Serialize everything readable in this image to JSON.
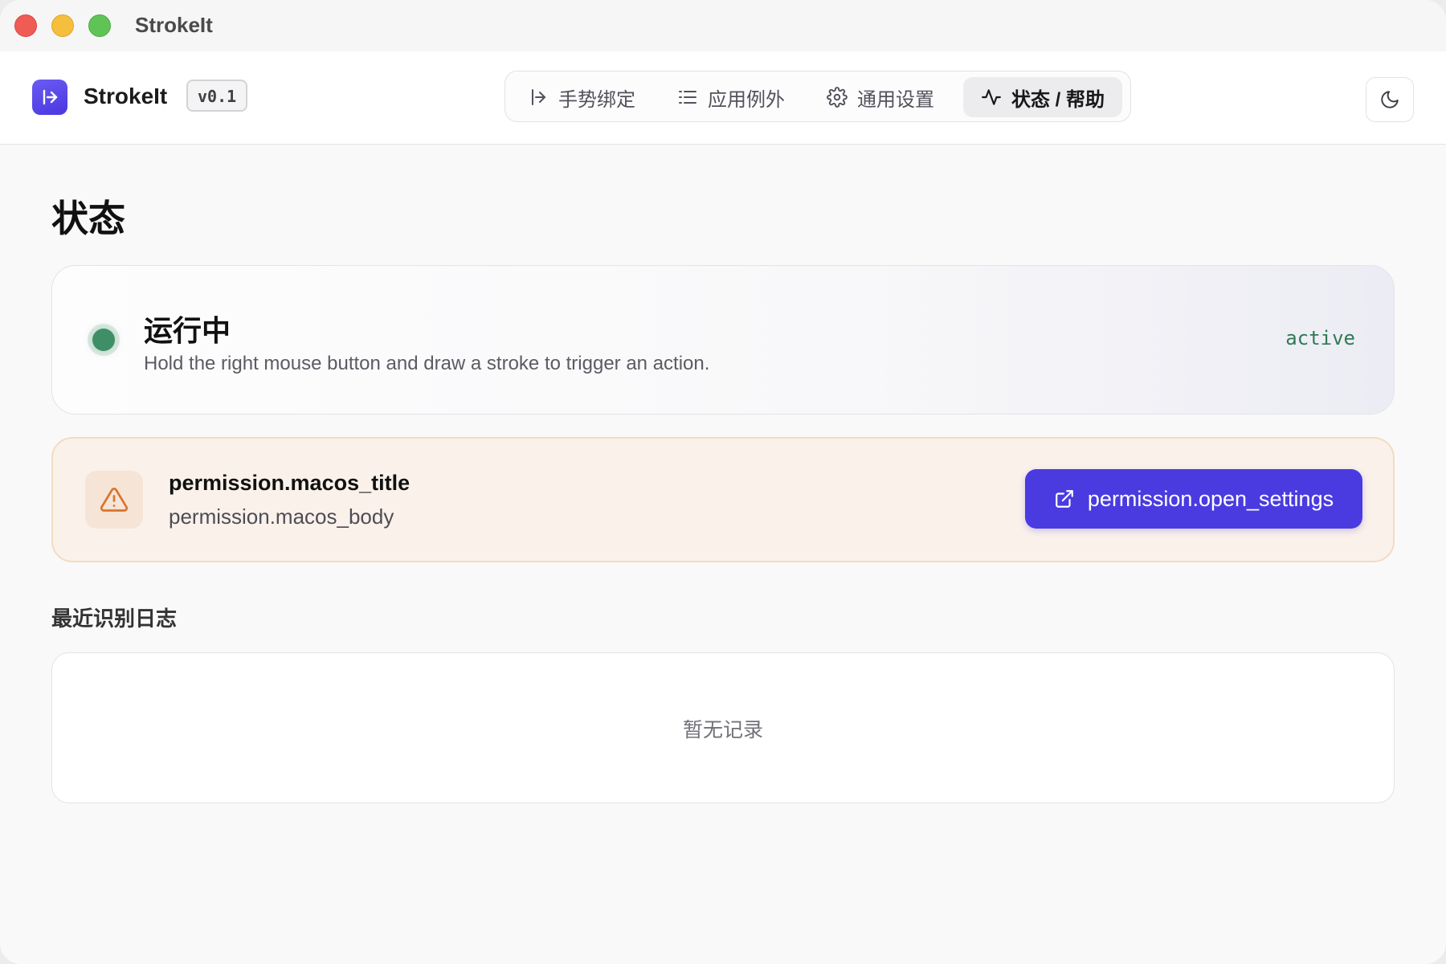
{
  "window": {
    "title": "StrokeIt"
  },
  "header": {
    "brand": "StrokeIt",
    "version": "v0.1",
    "tabs": [
      {
        "label": "手势绑定",
        "icon": "gesture-icon"
      },
      {
        "label": "应用例外",
        "icon": "list-icon"
      },
      {
        "label": "通用设置",
        "icon": "gear-icon"
      },
      {
        "label": "状态 / 帮助",
        "icon": "activity-icon"
      }
    ],
    "active_tab": "状态 / 帮助",
    "theme_toggle_icon": "moon-icon"
  },
  "page": {
    "title": "状态",
    "status": {
      "title": "运行中",
      "description": "Hold the right mouse button and draw a stroke to trigger an action.",
      "state": "active",
      "indicator_color": "#3f8f66"
    },
    "permission": {
      "icon": "warning-icon",
      "title": "permission.macos_title",
      "body": "permission.macos_body",
      "button_label": "permission.open_settings",
      "button_icon": "external-link-icon",
      "button_color": "#4a3be0"
    },
    "log": {
      "section_title": "最近识别日志",
      "empty_text": "暂无记录"
    }
  }
}
